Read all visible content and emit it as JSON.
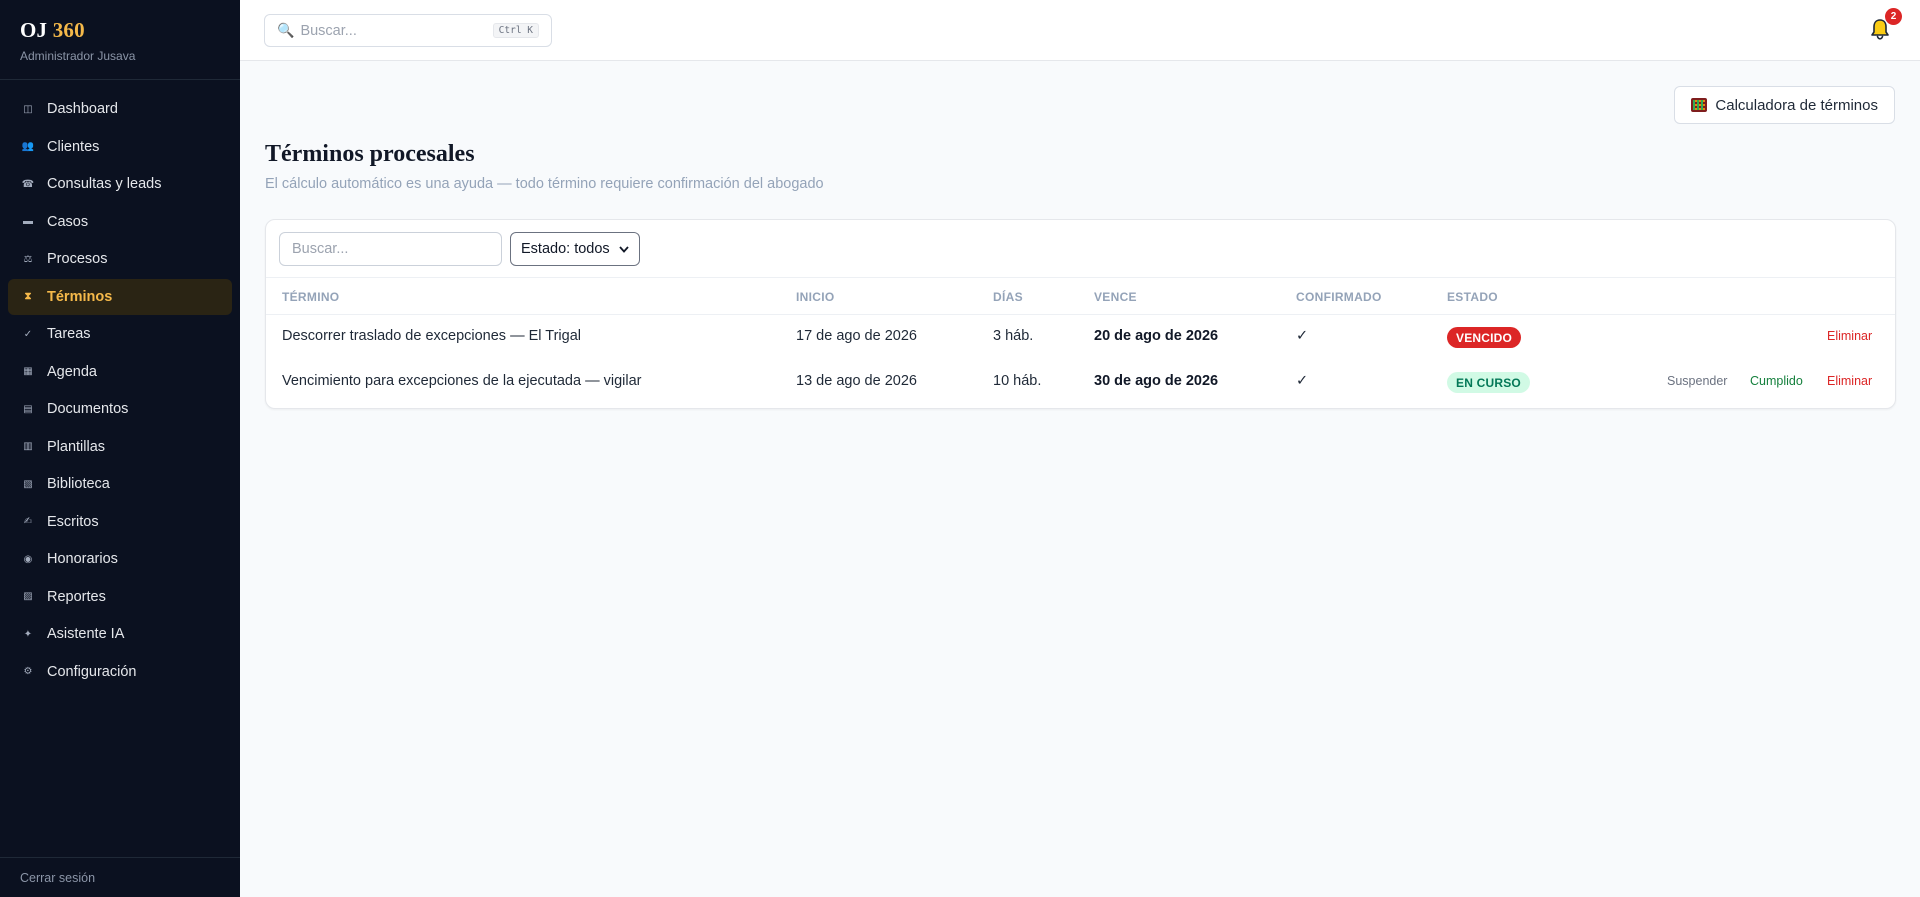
{
  "app": {
    "logo_main": "OJ ",
    "logo_accent": "360",
    "user": "Administrador Jusava"
  },
  "sidebar": {
    "items": [
      {
        "label": "Dashboard",
        "icon": "◫"
      },
      {
        "label": "Clientes",
        "icon": "👥"
      },
      {
        "label": "Consultas y leads",
        "icon": "☎"
      },
      {
        "label": "Casos",
        "icon": "▬"
      },
      {
        "label": "Procesos",
        "icon": "⚖"
      },
      {
        "label": "Términos",
        "icon": "⧗"
      },
      {
        "label": "Tareas",
        "icon": "✓"
      },
      {
        "label": "Agenda",
        "icon": "▦"
      },
      {
        "label": "Documentos",
        "icon": "▤"
      },
      {
        "label": "Plantillas",
        "icon": "▥"
      },
      {
        "label": "Biblioteca",
        "icon": "▧"
      },
      {
        "label": "Escritos",
        "icon": "✍"
      },
      {
        "label": "Honorarios",
        "icon": "◉"
      },
      {
        "label": "Reportes",
        "icon": "▨"
      },
      {
        "label": "Asistente IA",
        "icon": "✦"
      },
      {
        "label": "Configuración",
        "icon": "⚙"
      }
    ],
    "active": "Términos",
    "logout": "Cerrar sesión"
  },
  "topbar": {
    "search_placeholder": "Buscar...",
    "shortcut": "Ctrl K",
    "notifications_count": "2"
  },
  "page": {
    "calc_button": "Calculadora de términos",
    "title": "Términos procesales",
    "subtitle": "El cálculo automático es una ayuda — todo término requiere confirmación del abogado"
  },
  "filters": {
    "search_placeholder": "Buscar...",
    "status_selected": "Estado: todos"
  },
  "table": {
    "headers": {
      "termino": "TÉRMINO",
      "inicio": "INICIO",
      "dias": "DÍAS",
      "vence": "VENCE",
      "confirmado": "CONFIRMADO",
      "estado": "ESTADO"
    },
    "rows": [
      {
        "termino": "Descorrer traslado de excepciones — El Trigal",
        "inicio": "17 de ago de 2026",
        "dias": "3 háb.",
        "vence": "20 de ago de 2026",
        "confirmado": "✓",
        "estado": "VENCIDO",
        "estado_color": "#dc2626",
        "actions": {
          "eliminar": "Eliminar"
        }
      },
      {
        "termino": "Vencimiento para excepciones de la ejecutada — vigilar",
        "inicio": "13 de ago de 2026",
        "dias": "10 háb.",
        "vence": "30 de ago de 2026",
        "confirmado": "✓",
        "estado": "EN CURSO",
        "estado_color": "#d1fae5",
        "actions": {
          "suspender": "Suspender",
          "cumplido": "Cumplido",
          "eliminar": "Eliminar"
        }
      }
    ]
  }
}
